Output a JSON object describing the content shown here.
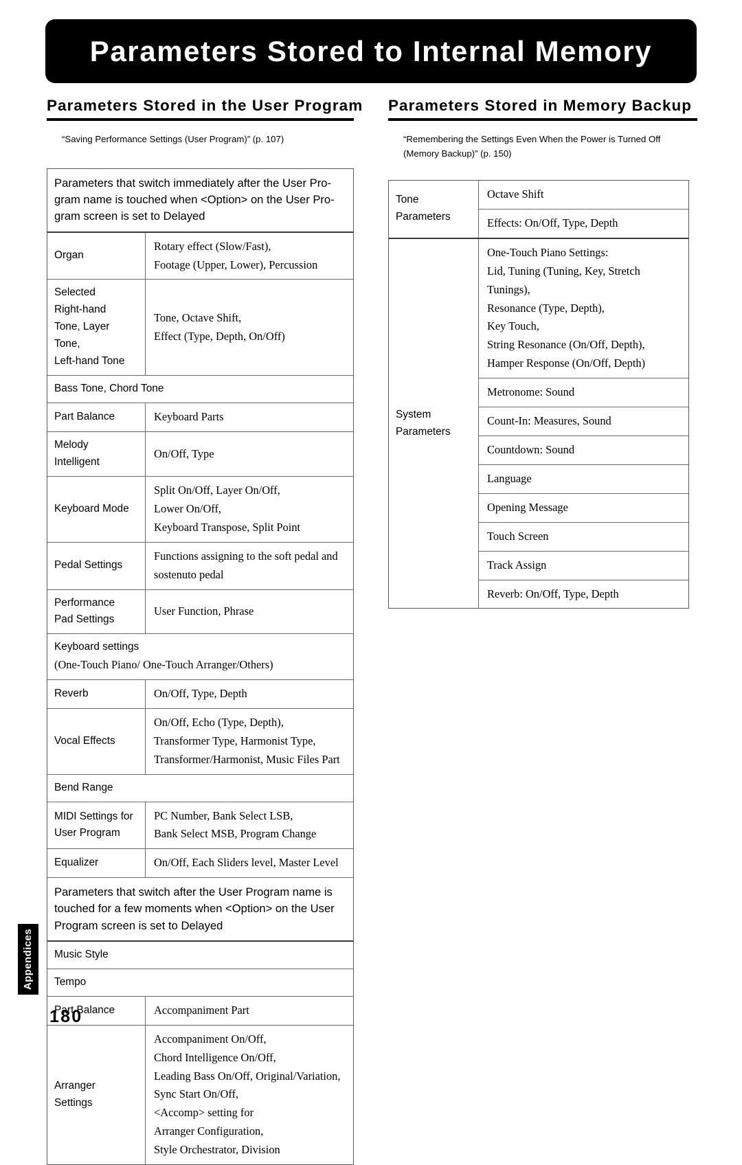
{
  "page": {
    "banner_title": "Parameters Stored to Internal Memory",
    "page_number": "180",
    "side_tab": "Appendices"
  },
  "left_section": {
    "heading": "Parameters Stored in the User Program",
    "caption": "“Saving Performance Settings (User Program)” (p. 107)",
    "table": {
      "banner_1": {
        "line1": "Parameters that switch immediately after the User Pro-",
        "line2": "gram name is touched when <Option> on the User Pro-",
        "line3": "gram screen is set to  Delayed"
      },
      "rows_1": [
        {
          "type": "pair",
          "label": [
            "Organ"
          ],
          "value": [
            "Rotary effect (Slow/Fast),",
            "Footage (Upper, Lower), Percussion"
          ]
        },
        {
          "type": "pair",
          "label": [
            "Selected",
            "Right-hand",
            "Tone, Layer",
            "Tone,",
            "Left-hand Tone"
          ],
          "value": [
            "Tone, Octave Shift,",
            "Effect (Type, Depth, On/Off)"
          ]
        },
        {
          "type": "full",
          "lines": [
            "Bass Tone, Chord Tone"
          ]
        },
        {
          "type": "pair",
          "label": [
            "Part Balance"
          ],
          "value": [
            "Keyboard Parts"
          ]
        },
        {
          "type": "pair",
          "label": [
            "Melody",
            "Intelligent"
          ],
          "value": [
            "On/Off, Type"
          ]
        },
        {
          "type": "pair",
          "label": [
            "Keyboard Mode"
          ],
          "value": [
            "Split On/Off, Layer On/Off,",
            "Lower On/Off,",
            "Keyboard Transpose, Split Point"
          ]
        },
        {
          "type": "pair",
          "label": [
            "Pedal Settings"
          ],
          "value": [
            "Functions assigning to the soft pedal and",
            "sostenuto pedal"
          ]
        },
        {
          "type": "pair",
          "label": [
            "Performance",
            "Pad Settings"
          ],
          "value": [
            "User Function, Phrase"
          ]
        },
        {
          "type": "full-mixed",
          "sans_lines": [
            "Keyboard settings"
          ],
          "serif_lines": [
            "(One-Touch Piano/ One-Touch Arranger/Others)"
          ]
        },
        {
          "type": "pair",
          "label": [
            "Reverb"
          ],
          "value": [
            "On/Off, Type, Depth"
          ]
        },
        {
          "type": "pair",
          "label": [
            "Vocal Effects"
          ],
          "value": [
            "On/Off, Echo (Type, Depth),",
            "Transformer Type, Harmonist Type,",
            "Transformer/Harmonist, Music Files Part"
          ]
        },
        {
          "type": "full",
          "lines": [
            "Bend Range"
          ]
        },
        {
          "type": "pair",
          "label": [
            "MIDI Settings for",
            "User Program"
          ],
          "value": [
            "PC Number, Bank Select LSB,",
            "Bank Select MSB, Program Change"
          ]
        },
        {
          "type": "pair",
          "label": [
            "Equalizer"
          ],
          "value": [
            "On/Off, Each Sliders level, Master Level"
          ]
        }
      ],
      "banner_2": {
        "line1": "Parameters that switch after the User Program name is",
        "line2": "touched for a few moments when <Option> on the User",
        "line3": "Program screen is set to  Delayed"
      },
      "rows_2": [
        {
          "type": "full",
          "lines": [
            "Music Style"
          ]
        },
        {
          "type": "full",
          "lines": [
            "Tempo"
          ]
        },
        {
          "type": "pair",
          "label": [
            "Part Balance"
          ],
          "value": [
            "Accompaniment Part"
          ]
        },
        {
          "type": "pair",
          "label": [
            "Arranger",
            "Settings"
          ],
          "value": [
            "Accompaniment On/Off,",
            "Chord Intelligence On/Off,",
            "Leading Bass On/Off, Original/Variation,",
            "Sync Start On/Off,",
            "<Accomp> setting for",
            "Arranger Configuration,",
            "Style Orchestrator, Division"
          ]
        }
      ]
    }
  },
  "right_section": {
    "heading": "Parameters Stored in Memory Backup",
    "caption": "“Remembering the Settings Even When the Power is Turned Off (Memory Backup)” (p. 150)",
    "table": {
      "groups": [
        {
          "label": [
            "Tone",
            "Parameters"
          ],
          "rows": [
            {
              "lines": [
                "Octave Shift"
              ]
            },
            {
              "lines": [
                "Effects: On/Off, Type, Depth"
              ]
            }
          ]
        },
        {
          "label": [
            "System",
            "Parameters"
          ],
          "rows": [
            {
              "lines": [
                "One-Touch Piano Settings:",
                "Lid, Tuning (Tuning, Key, Stretch Tunings),",
                "Resonance (Type, Depth),",
                "Key Touch,",
                "String Resonance (On/Off, Depth),",
                "Hamper Response (On/Off, Depth)"
              ]
            },
            {
              "lines": [
                "Metronome: Sound"
              ]
            },
            {
              "lines": [
                "Count-In: Measures, Sound"
              ]
            },
            {
              "lines": [
                "Countdown: Sound"
              ]
            },
            {
              "lines": [
                "Language"
              ]
            },
            {
              "lines": [
                "Opening Message"
              ]
            },
            {
              "lines": [
                "Touch Screen"
              ]
            },
            {
              "lines": [
                "Track Assign"
              ]
            },
            {
              "lines": [
                "Reverb: On/Off, Type, Depth"
              ]
            }
          ]
        }
      ]
    }
  }
}
